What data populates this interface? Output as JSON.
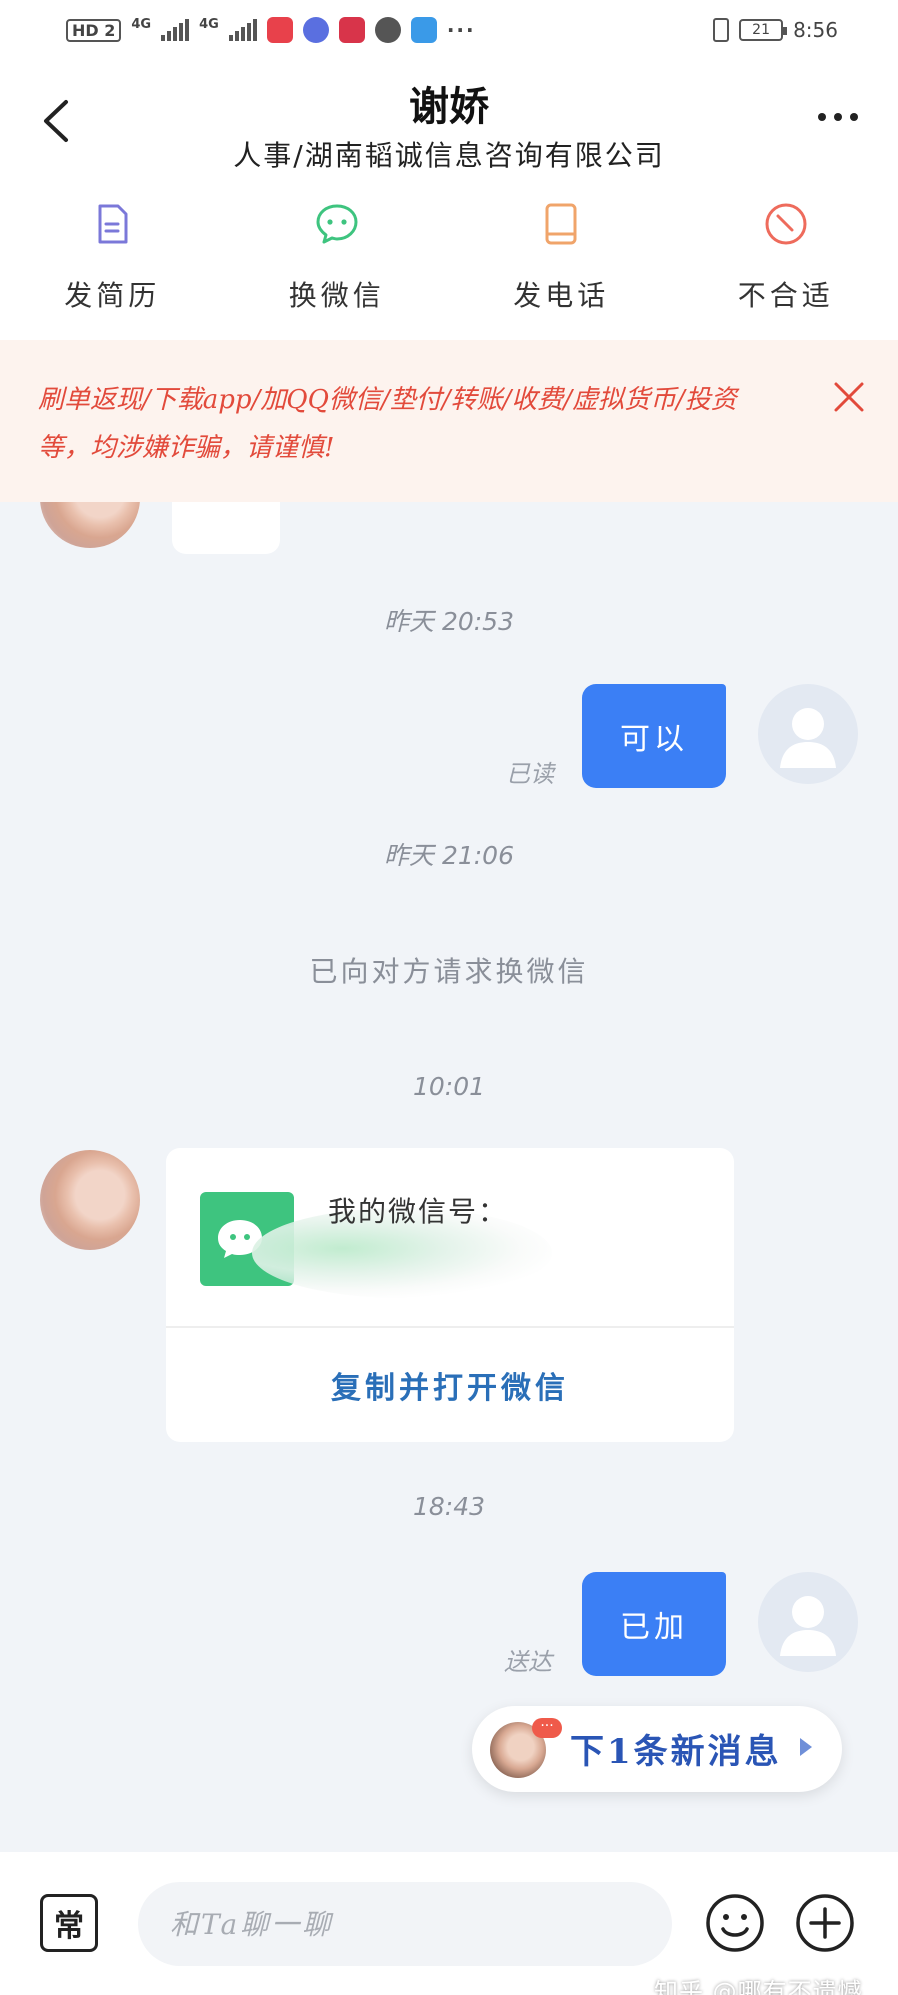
{
  "status_bar": {
    "hd_badge": "HD 2",
    "network_1": "4G",
    "network_2": "4G",
    "battery": "21",
    "time": "8:56"
  },
  "header": {
    "contact_name": "谢娇",
    "contact_subtitle": "人事/湖南韬诚信息咨询有限公司"
  },
  "actions": [
    {
      "label": "发简历",
      "icon": "resume-icon",
      "color": "#7b78d9"
    },
    {
      "label": "换微信",
      "icon": "wechat-icon",
      "color": "#3ec47f"
    },
    {
      "label": "发电话",
      "icon": "phone-icon",
      "color": "#f0a46a"
    },
    {
      "label": "不合适",
      "icon": "not-suitable-icon",
      "color": "#ee6b5c"
    }
  ],
  "warning": {
    "text": "刷单返现/下载app/加QQ微信/垫付/转账/收费/虚拟货币/投资等，均涉嫌诈骗，请谨慎!"
  },
  "chat": {
    "messages": [
      {
        "type": "timestamp",
        "text": "昨天 20:53"
      },
      {
        "type": "outgoing",
        "text": "可以",
        "status": "已读"
      },
      {
        "type": "timestamp",
        "text": "昨天 21:06"
      },
      {
        "type": "system",
        "text": "已向对方请求换微信"
      },
      {
        "type": "timestamp",
        "text": "10:01"
      },
      {
        "type": "wechat_card",
        "label": "我的微信号：",
        "action": "复制并打开微信"
      },
      {
        "type": "timestamp",
        "text": "18:43"
      },
      {
        "type": "outgoing",
        "text": "已加",
        "status": "送达"
      }
    ]
  },
  "new_message_pill": {
    "text": "下1条新消息",
    "badge": "···"
  },
  "input_bar": {
    "common_label": "常",
    "placeholder": "和Ta聊一聊"
  },
  "watermark": "知乎 @哪有不遗憾",
  "colors": {
    "accent_blue": "#3b7ff5",
    "warning_red": "#e24a3b",
    "wechat_green": "#3ec47f",
    "link_blue": "#2a6fb8"
  }
}
